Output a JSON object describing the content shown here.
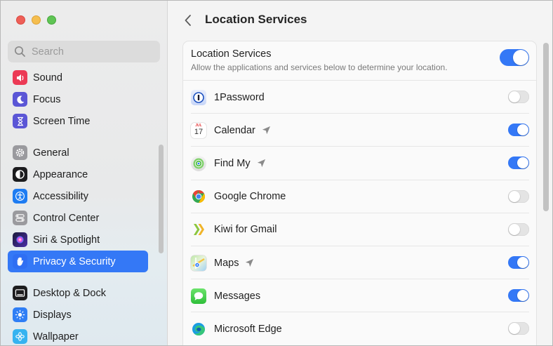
{
  "search": {
    "placeholder": "Search"
  },
  "sidebar": {
    "items": [
      {
        "label": "Sound",
        "icon": "sound-icon",
        "color": "#ec3a55"
      },
      {
        "label": "Focus",
        "icon": "moon-icon",
        "color": "#5b56d6"
      },
      {
        "label": "Screen Time",
        "icon": "hourglass-icon",
        "color": "#5b56d6"
      },
      {
        "label": "General",
        "icon": "gear-icon",
        "color": "#9a9a9e"
      },
      {
        "label": "Appearance",
        "icon": "appearance-icon",
        "color": "#1c1c1e"
      },
      {
        "label": "Accessibility",
        "icon": "accessibility-icon",
        "color": "#1e7cf2"
      },
      {
        "label": "Control Center",
        "icon": "control-center-icon",
        "color": "#9a9a9e"
      },
      {
        "label": "Siri & Spotlight",
        "icon": "siri-icon",
        "color": "#6a3fd8"
      },
      {
        "label": "Privacy & Security",
        "icon": "hand-icon",
        "color": "#2f6ff3",
        "selected": true
      },
      {
        "label": "Desktop & Dock",
        "icon": "dock-icon",
        "color": "#1c1c1e"
      },
      {
        "label": "Displays",
        "icon": "displays-icon",
        "color": "#2f7ef5"
      },
      {
        "label": "Wallpaper",
        "icon": "wallpaper-icon",
        "color": "#36b3f0"
      }
    ]
  },
  "header": {
    "title": "Location Services"
  },
  "master": {
    "title": "Location Services",
    "description": "Allow the applications and services below to determine your location.",
    "enabled": true
  },
  "apps": [
    {
      "name": "1Password",
      "icon": "onepassword-icon",
      "enabled": false,
      "recent": false
    },
    {
      "name": "Calendar",
      "icon": "calendar-icon",
      "enabled": true,
      "recent": true,
      "calendar_month": "JUL",
      "calendar_day": "17"
    },
    {
      "name": "Find My",
      "icon": "find-my-icon",
      "enabled": true,
      "recent": true
    },
    {
      "name": "Google Chrome",
      "icon": "chrome-icon",
      "enabled": false,
      "recent": false
    },
    {
      "name": "Kiwi for Gmail",
      "icon": "kiwi-icon",
      "enabled": false,
      "recent": false
    },
    {
      "name": "Maps",
      "icon": "maps-icon",
      "enabled": true,
      "recent": true
    },
    {
      "name": "Messages",
      "icon": "messages-icon",
      "enabled": true,
      "recent": false
    },
    {
      "name": "Microsoft Edge",
      "icon": "edge-icon",
      "enabled": false,
      "recent": false
    }
  ],
  "colors": {
    "accent": "#3478f6",
    "toggle_off": "#e4e4e4"
  }
}
